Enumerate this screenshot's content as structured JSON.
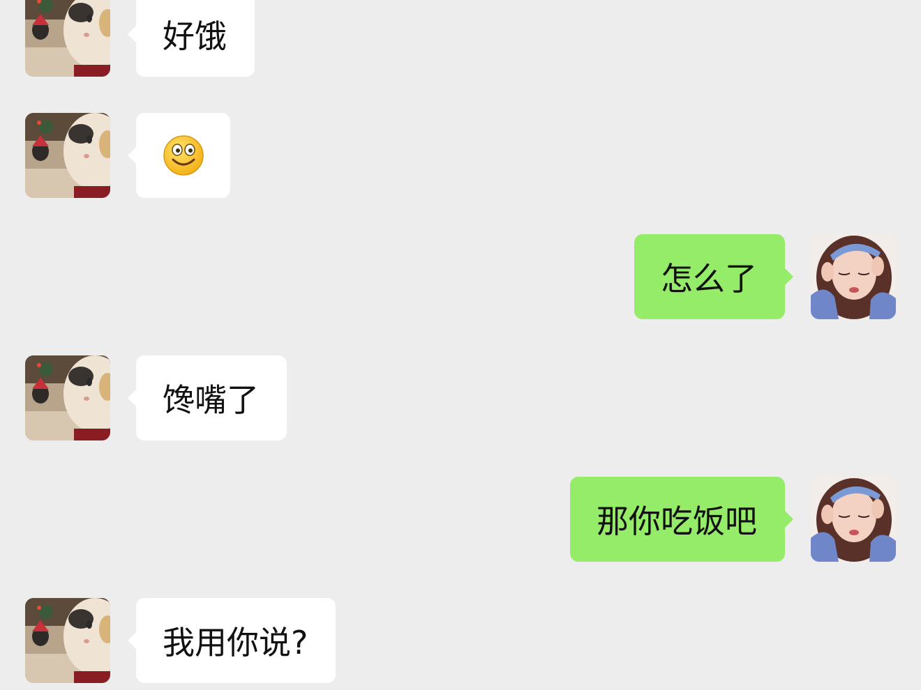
{
  "chat": {
    "contact_avatar": "cat-avatar",
    "self_avatar": "girl-avatar",
    "colors": {
      "background": "#ededed",
      "incoming": "#ffffff",
      "outgoing": "#95ec69"
    },
    "messages": [
      {
        "side": "incoming",
        "text": "好饿"
      },
      {
        "side": "incoming",
        "emoji": "smile-emoji-icon"
      },
      {
        "side": "outgoing",
        "text": "怎么了"
      },
      {
        "side": "incoming",
        "text": "馋嘴了"
      },
      {
        "side": "outgoing",
        "text": "那你吃饭吧"
      },
      {
        "side": "incoming",
        "text": "我用你说?"
      }
    ]
  }
}
